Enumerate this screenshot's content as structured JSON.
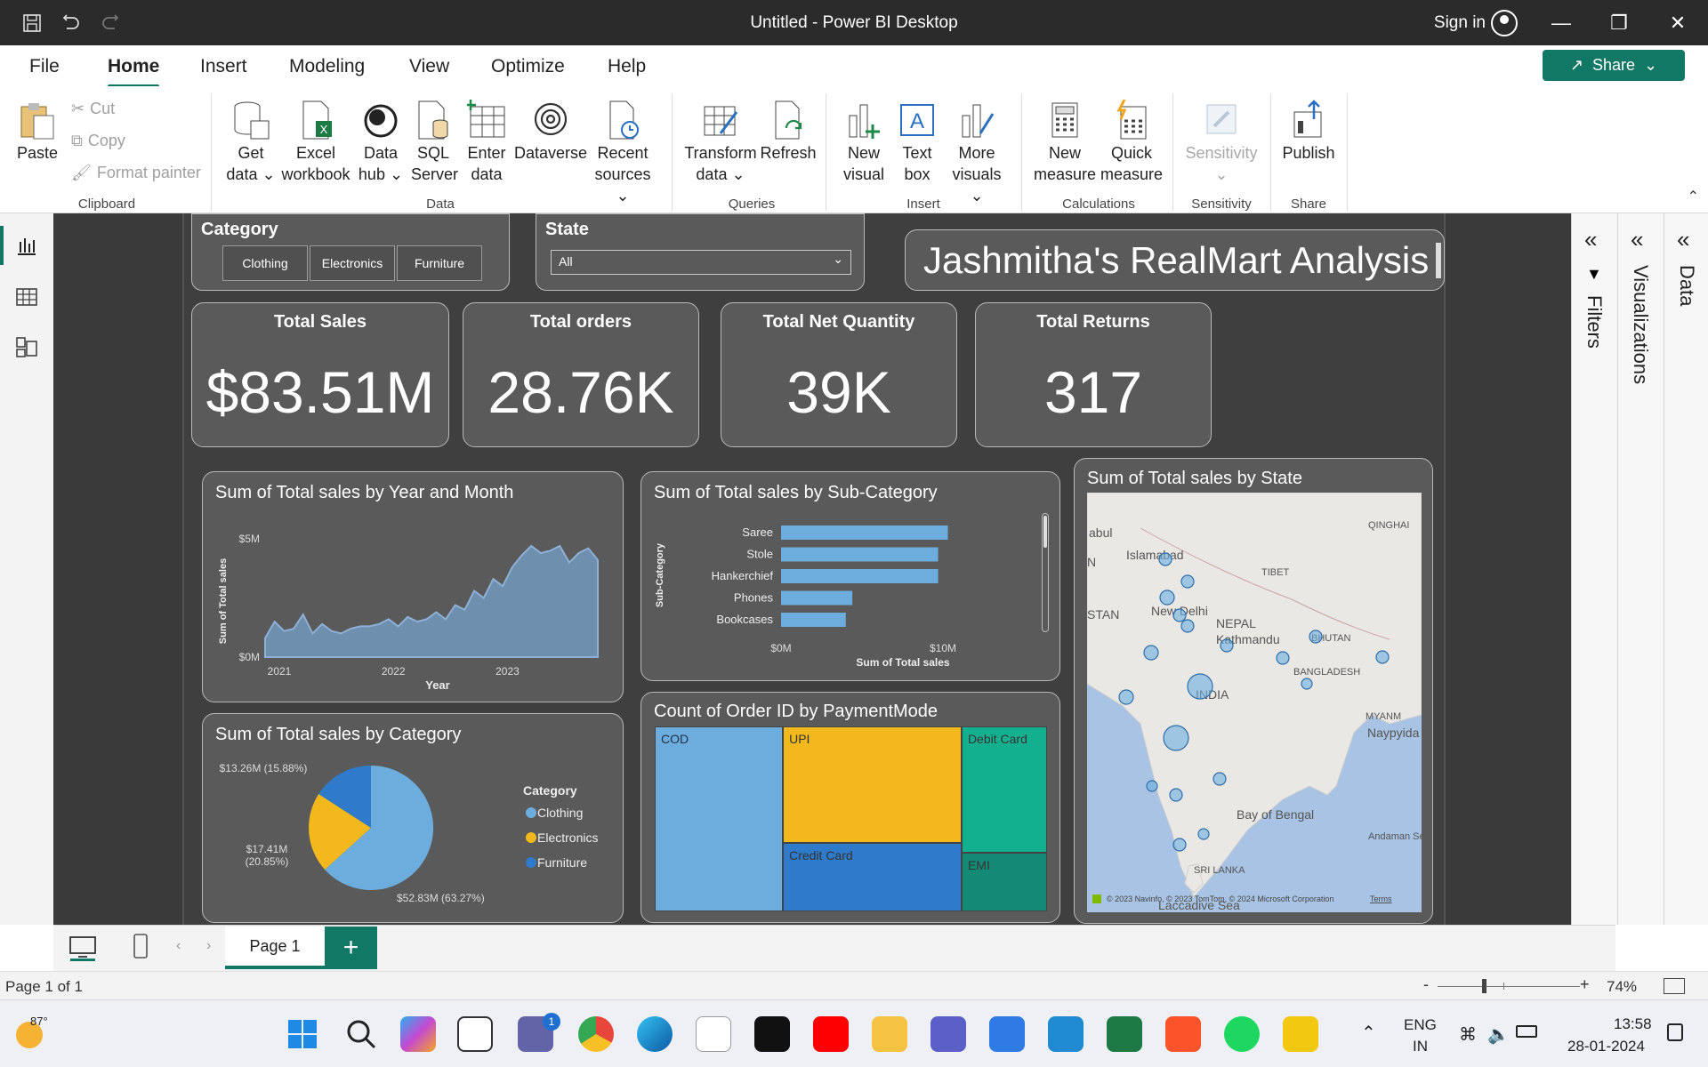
{
  "titlebar": {
    "title": "Untitled - Power BI Desktop",
    "sign_in": "Sign in"
  },
  "menu": {
    "items": [
      "File",
      "Home",
      "Insert",
      "Modeling",
      "View",
      "Optimize",
      "Help"
    ],
    "active": "Home",
    "share": "Share"
  },
  "ribbon": {
    "paste": "Paste",
    "cut": "Cut",
    "copy": "Copy",
    "format_painter": "Format painter",
    "get_data": [
      "Get",
      "data"
    ],
    "excel": [
      "Excel",
      "workbook"
    ],
    "data_hub": [
      "Data",
      "hub"
    ],
    "sql": [
      "SQL",
      "Server"
    ],
    "enter": [
      "Enter",
      "data"
    ],
    "dataverse": "Dataverse",
    "recent": [
      "Recent",
      "sources"
    ],
    "transform": [
      "Transform",
      "data"
    ],
    "refresh": "Refresh",
    "new_visual": [
      "New",
      "visual"
    ],
    "text_box": [
      "Text",
      "box"
    ],
    "more_visuals": [
      "More",
      "visuals"
    ],
    "new_measure": [
      "New",
      "measure"
    ],
    "quick_measure": [
      "Quick",
      "measure"
    ],
    "sensitivity": "Sensitivity",
    "publish": "Publish",
    "groups": {
      "clipboard": "Clipboard",
      "data": "Data",
      "queries": "Queries",
      "insert": "Insert",
      "calculations": "Calculations",
      "sensitivity": "Sensitivity",
      "share": "Share"
    }
  },
  "report": {
    "category_slicer": {
      "title": "Category",
      "options": [
        "Clothing",
        "Electronics",
        "Furniture"
      ]
    },
    "state_slicer": {
      "title": "State",
      "value": "All"
    },
    "report_title": "Jashmitha's RealMart Analysis",
    "kpis": [
      {
        "label": "Total Sales",
        "value": "$83.51M"
      },
      {
        "label": "Total orders",
        "value": "28.76K"
      },
      {
        "label": "Total Net Quantity",
        "value": "39K"
      },
      {
        "label": "Total Returns",
        "value": "317"
      }
    ],
    "visual_titles": {
      "area": "Sum of Total sales by Year and Month",
      "bar": "Sum of Total sales by Sub-Category",
      "map": "Sum of Total sales by State",
      "pie": "Sum of Total sales by Category",
      "treemap": "Count of Order ID by PaymentMode"
    },
    "map": {
      "labels": [
        "abul",
        "N",
        "Islamabad",
        "QINGHAI",
        "TIBET",
        "STAN",
        "New Delhi",
        "NEPAL",
        "Kathmandu",
        "BHUTAN",
        "BANGLADESH",
        "INDIA",
        "MYANM",
        "Naypyida",
        "Bay of Bengal",
        "Andaman Sea",
        "SRI LANKA",
        "Laccadive Sea"
      ],
      "attribution": "© 2023 Navinfo, © 2023 TomTom, © 2024 Microsoft Corporation",
      "terms": "Terms"
    }
  },
  "chart_data": [
    {
      "type": "area",
      "title": "Sum of Total sales by Year and Month",
      "xlabel": "Year",
      "ylabel": "Sum of Total sales",
      "x_ticks": [
        "2021",
        "2022",
        "2023"
      ],
      "y_ticks": [
        "$0M",
        "$5M"
      ],
      "ylim": [
        0,
        5
      ],
      "x": [
        "2021-01",
        "2021-02",
        "2021-03",
        "2021-04",
        "2021-05",
        "2021-06",
        "2021-07",
        "2021-08",
        "2021-09",
        "2021-10",
        "2021-11",
        "2021-12",
        "2022-01",
        "2022-02",
        "2022-03",
        "2022-04",
        "2022-05",
        "2022-06",
        "2022-07",
        "2022-08",
        "2022-09",
        "2022-10",
        "2022-11",
        "2022-12",
        "2023-01",
        "2023-02",
        "2023-03",
        "2023-04",
        "2023-05",
        "2023-06",
        "2023-07",
        "2023-08",
        "2023-09",
        "2023-10",
        "2023-11",
        "2023-12"
      ],
      "values": [
        0.8,
        1.5,
        1.1,
        1.2,
        1.8,
        1.0,
        1.4,
        1.1,
        1.0,
        1.2,
        1.3,
        1.3,
        1.4,
        1.6,
        1.3,
        1.7,
        1.5,
        1.6,
        1.9,
        1.6,
        2.2,
        2.0,
        2.8,
        2.5,
        3.3,
        3.0,
        3.8,
        4.3,
        4.7,
        4.4,
        4.5,
        4.7,
        4.0,
        4.4,
        4.6,
        4.1
      ]
    },
    {
      "type": "bar",
      "orientation": "horizontal",
      "title": "Sum of Total sales by Sub-Category",
      "xlabel": "Sum of Total sales",
      "ylabel": "Sub-Category",
      "x_ticks": [
        "$0M",
        "$10M"
      ],
      "xlim": [
        0,
        10
      ],
      "categories": [
        "Saree",
        "Stole",
        "Hankerchief",
        "Phones",
        "Bookcases"
      ],
      "values": [
        10.3,
        9.7,
        9.7,
        4.4,
        4.0
      ]
    },
    {
      "type": "pie",
      "title": "Sum of Total sales by Category",
      "legend_title": "Category",
      "categories": [
        "Clothing",
        "Electronics",
        "Furniture"
      ],
      "values": [
        52.83,
        17.41,
        13.26
      ],
      "data_labels": [
        "$52.83M (63.27%)",
        "$17.41M (20.85%)",
        "$13.26M (15.88%)"
      ],
      "colors": [
        "#6cadde",
        "#f2b81c",
        "#2f7ac9"
      ]
    },
    {
      "type": "treemap",
      "title": "Count of Order ID by PaymentMode",
      "categories": [
        "COD",
        "UPI",
        "Debit Card",
        "Credit Card",
        "EMI"
      ],
      "values": [
        33,
        29,
        15,
        17,
        7
      ],
      "colors": [
        "#6cadde",
        "#f2b81c",
        "#13b08f",
        "#2f7ac9",
        "#138a76"
      ]
    }
  ],
  "pages": {
    "tab": "Page 1",
    "add": "+"
  },
  "status": {
    "page": "Page 1 of 1",
    "zoom": "74%",
    "minus": "-",
    "plus": "+"
  },
  "panes": {
    "filters": "Filters",
    "visualizations": "Visualizations",
    "data": "Data"
  },
  "taskbar": {
    "weather": "87°",
    "lang": "ENG",
    "region": "IN",
    "time": "13:58",
    "date": "28-01-2024",
    "badge": "1"
  },
  "colors": {
    "accent": "#117865",
    "canvas": "#3f3f3f",
    "card": "#5a5a5a"
  }
}
